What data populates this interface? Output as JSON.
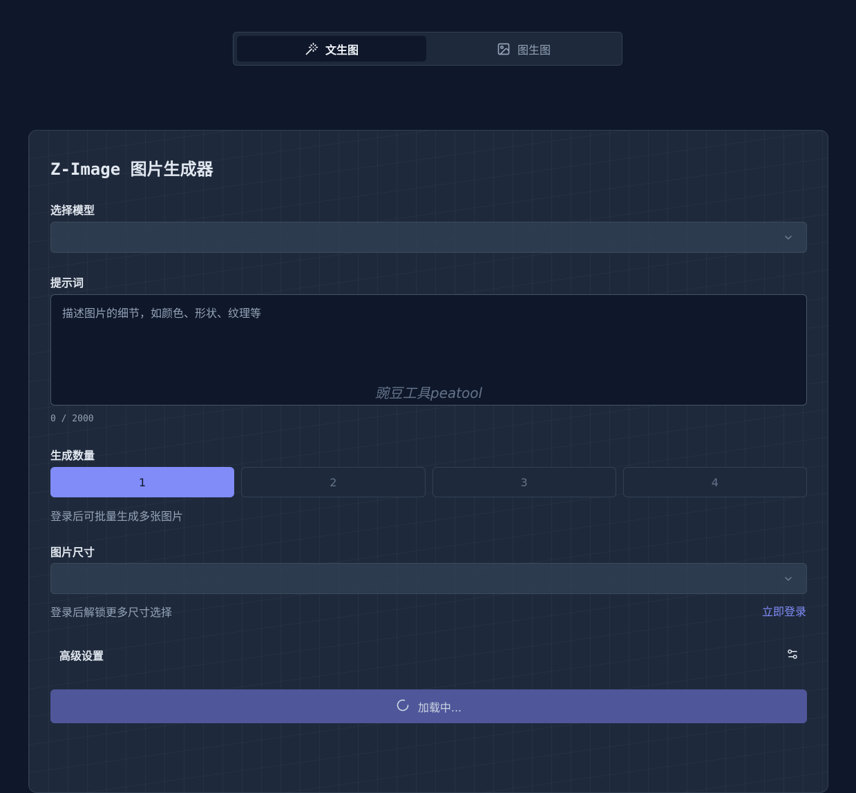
{
  "tabs": [
    {
      "label": "文生图",
      "icon": "magic-wand-icon",
      "active": true
    },
    {
      "label": "图生图",
      "icon": "image-icon",
      "active": false
    }
  ],
  "card": {
    "title": "Z-Image 图片生成器",
    "model": {
      "label": "选择模型",
      "value": ""
    },
    "prompt": {
      "label": "提示词",
      "placeholder": "描述图片的细节，如颜色、形状、纹理等",
      "watermark": "豌豆工具peatool",
      "counter": "0 / 2000"
    },
    "quantity": {
      "label": "生成数量",
      "options": [
        "1",
        "2",
        "3",
        "4"
      ],
      "selected": "1",
      "hint": "登录后可批量生成多张图片"
    },
    "size": {
      "label": "图片尺寸",
      "value": "",
      "hint": "登录后解锁更多尺寸选择",
      "login_link": "立即登录"
    },
    "advanced": {
      "label": "高级设置",
      "icon": "settings-sliders-icon"
    },
    "submit": {
      "label": "加载中...",
      "icon": "spinner-icon"
    }
  },
  "colors": {
    "background": "#0f172a",
    "card": "#1e293b",
    "accent": "#818cf8",
    "button": "#4f569a"
  }
}
